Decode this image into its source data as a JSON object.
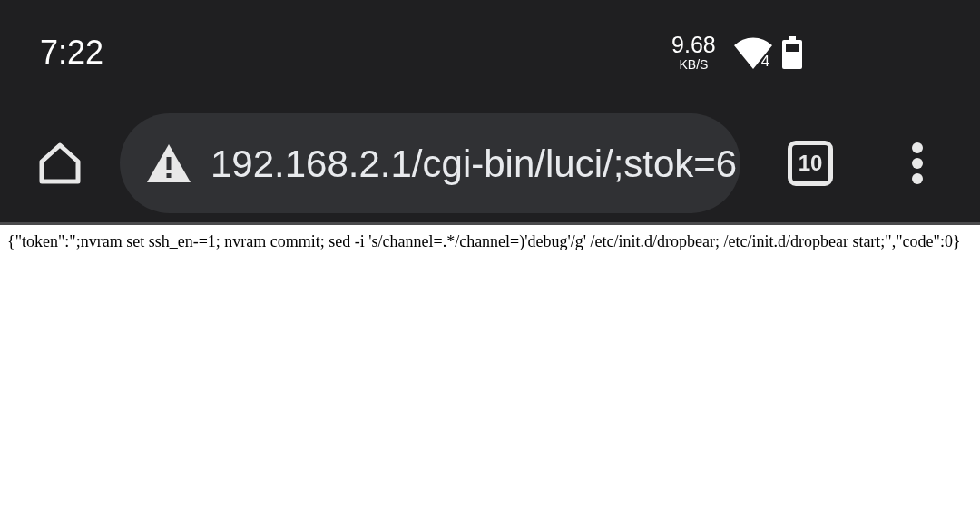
{
  "status_bar": {
    "time": "7:22",
    "speed": "9.68",
    "speed_unit": "KB/S",
    "network": "4"
  },
  "toolbar": {
    "url": "192.168.2.1/cgi-bin/luci/;stok=6",
    "tab_count": "10"
  },
  "page": {
    "text": "{\"token\":\";nvram set ssh_en-=1; nvram commit; sed -i 's/channel=.*/channel=)'debug'/g' /etc/init.d/dropbear; /etc/init.d/dropbear start;\",\"code\":0}"
  }
}
